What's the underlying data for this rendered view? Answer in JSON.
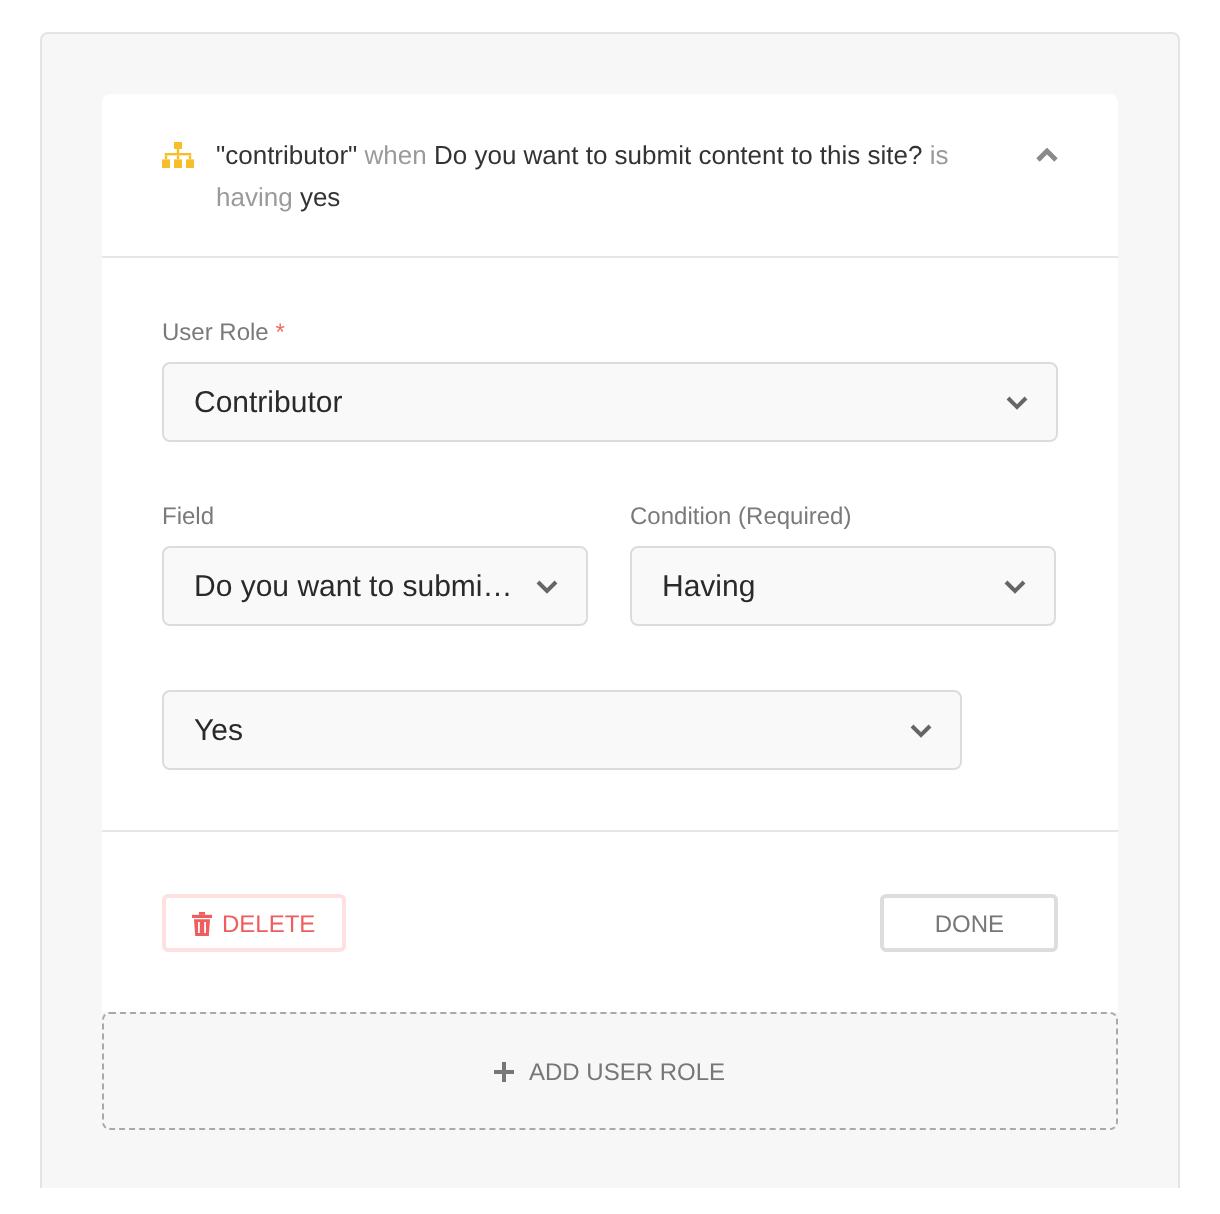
{
  "rule": {
    "expanded": true,
    "summary": [
      {
        "kind": "value",
        "text": "\"contributor\""
      },
      {
        "kind": "keyword",
        "text": "when"
      },
      {
        "kind": "value",
        "text": "Do you want to submit content to this site?"
      },
      {
        "kind": "keyword",
        "text": "is having"
      },
      {
        "kind": "value",
        "text": "yes"
      }
    ]
  },
  "user_role": {
    "label": "User Role",
    "required_mark": "*",
    "value": "Contributor"
  },
  "field": {
    "label": "Field",
    "value": "Do you want to submi…"
  },
  "condition": {
    "label": "Condition (Required)",
    "value": "Having"
  },
  "answer": {
    "value": "Yes"
  },
  "actions": {
    "delete": "DELETE",
    "done": "DONE"
  },
  "add_button": "ADD USER ROLE"
}
